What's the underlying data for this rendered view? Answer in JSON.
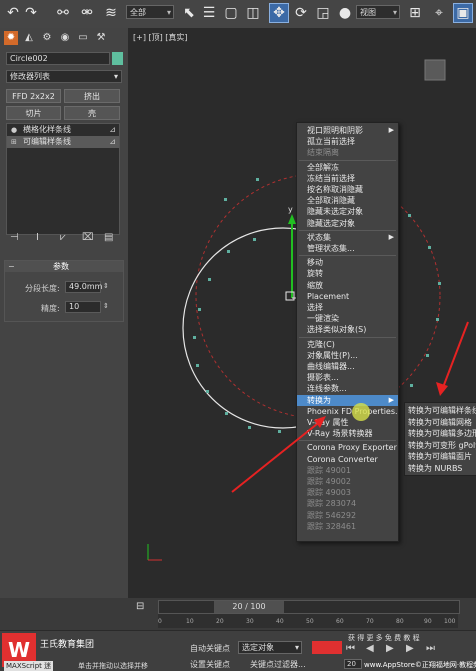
{
  "toolbar": {
    "selection_filter": "全部",
    "view_select": "视图",
    "icons": [
      "undo-icon",
      "redo-icon",
      "link-icon",
      "unlink-icon",
      "bind-space-warp-icon",
      "select-object-icon",
      "select-by-name-icon",
      "rect-selection-icon",
      "window-crossing-icon",
      "select-move-icon",
      "select-rotate-icon",
      "select-scale-icon",
      "view-dropdown-icon"
    ]
  },
  "panel": {
    "object_name": "Circle002",
    "object_color": "#5fbf9f",
    "modifier_list": "修改器列表",
    "buttons": [
      "FFD 2x2x2",
      "挤出",
      "切片",
      "壳"
    ],
    "stack_items": [
      {
        "label": "横格化样条线",
        "selected": false
      },
      {
        "label": "可编辑样条线",
        "selected": true
      }
    ],
    "rollout_title": "参数",
    "params": [
      {
        "label": "分段长度:",
        "value": "49.0mm"
      },
      {
        "label": "精度:",
        "value": "10"
      }
    ]
  },
  "viewport": {
    "label": "[+] [顶] [真实]",
    "axis_labels": [
      "x",
      "y"
    ]
  },
  "context_menu": {
    "groups": [
      [
        {
          "label": "视口照明和阴影",
          "sub": true
        },
        {
          "label": "孤立当前选择"
        },
        {
          "label": "结束隔离",
          "dim": true
        }
      ],
      [
        {
          "label": "全部解冻"
        },
        {
          "label": "冻结当前选择"
        },
        {
          "label": "按名称取消隐藏"
        },
        {
          "label": "全部取消隐藏"
        },
        {
          "label": "隐藏未选定对象"
        },
        {
          "label": "隐藏选定对象"
        }
      ],
      [
        {
          "label": "状态集",
          "sub": true
        },
        {
          "label": "管理状态集..."
        }
      ],
      [
        {
          "label": "移动"
        },
        {
          "label": "旋转"
        },
        {
          "label": "缩放"
        },
        {
          "label": "Placement"
        },
        {
          "label": "选择"
        },
        {
          "label": "一键渲染"
        },
        {
          "label": "选择类似对象(S)"
        }
      ],
      [
        {
          "label": "克隆(C)"
        },
        {
          "label": "对象属性(P)..."
        },
        {
          "label": "曲线编辑器..."
        },
        {
          "label": "摄影表..."
        },
        {
          "label": "连线参数..."
        },
        {
          "label": "转换为",
          "sub": true,
          "highlight": true
        },
        {
          "label": "Phoenix FD Properties..."
        },
        {
          "label": "V-Ray 属性"
        },
        {
          "label": "V-Ray 场景转换器"
        }
      ],
      [
        {
          "label": "Corona Proxy Exporter"
        },
        {
          "label": "Corona Converter"
        },
        {
          "label": "跟踪 49001",
          "dim": true
        },
        {
          "label": "跟踪 49002",
          "dim": true
        },
        {
          "label": "跟踪 49003",
          "dim": true
        },
        {
          "label": "跟踪 283074",
          "dim": true
        },
        {
          "label": "跟踪 546292",
          "dim": true
        },
        {
          "label": "跟踪 328461",
          "dim": true
        }
      ]
    ]
  },
  "submenu": {
    "items": [
      "转换为可编辑样条线",
      "转换为可编辑网格",
      "转换为可编辑多边形",
      "转换为可变形 gPoly",
      "转换为可编辑面片",
      "转换为 NURBS"
    ]
  },
  "timeline": {
    "frame": "20 / 100",
    "ticks": [
      "0",
      "10",
      "20",
      "30",
      "40",
      "50",
      "60",
      "70",
      "80",
      "90",
      "100"
    ]
  },
  "status": {
    "brand": "王氏教育集团",
    "maxscript": "MAXScript 迷",
    "hint": "单击并拖动以选择并移",
    "auto_key": "自动关键点",
    "set_key": "设置关键点",
    "selected_obj": "选定对象",
    "key_filter": "关键点过滤器...",
    "frame_field": "20",
    "watermark": "www.AppStore©正翔福地网·教程频道",
    "right_icons": "获 得 更 多 免 费 教 程"
  },
  "colors": {
    "menu_highlight": "#4d8ac9",
    "arrow_red": "#e62222",
    "dots": "#5fb0a0",
    "red_circle": "#b03030"
  }
}
